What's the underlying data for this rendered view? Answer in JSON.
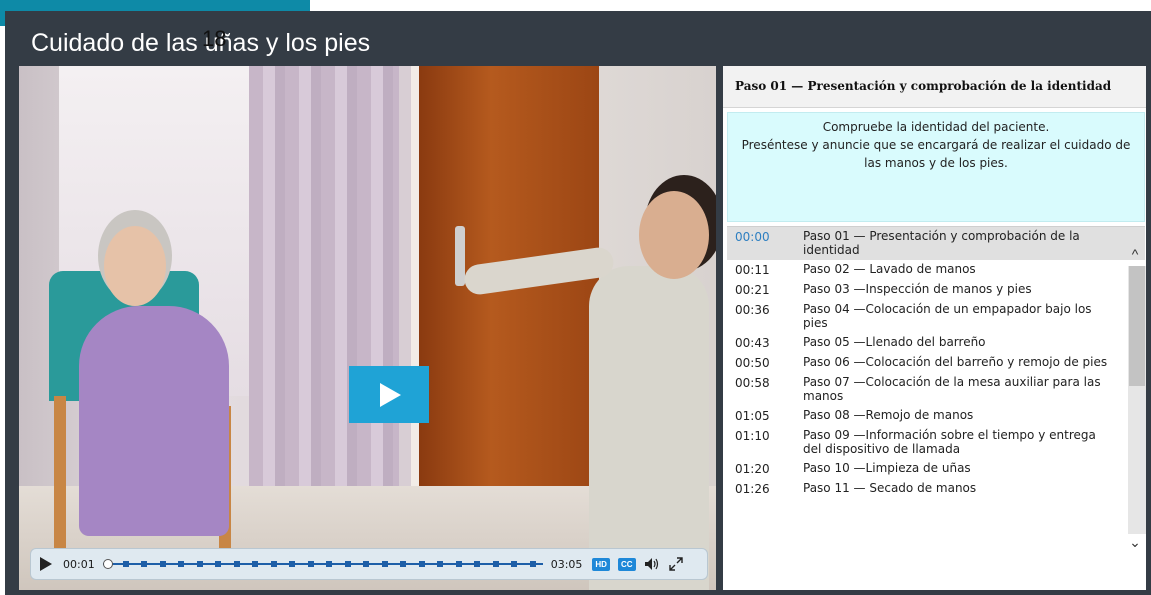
{
  "header": {
    "tab_number": "18",
    "title": "Cuidado de las uñas y los pies"
  },
  "player": {
    "current_time": "00:01",
    "total_time": "03:05",
    "hd_label": "HD",
    "cc_label": "CC",
    "progress_fraction": 0.005
  },
  "panel": {
    "step_title": "Paso 01 — Presentación y comprobación de la identidad",
    "description_lines": [
      "Compruebe la identidad del paciente.",
      "Preséntese y anuncie que se encargará de realizar el cuidado de",
      "las manos y de los pies."
    ],
    "chapters": [
      {
        "time": "00:00",
        "title": "Paso 01 — Presentación y comprobación de la identidad"
      },
      {
        "time": "00:11",
        "title": "Paso 02 — Lavado de manos"
      },
      {
        "time": "00:21",
        "title": "Paso 03 —Inspección de manos y pies"
      },
      {
        "time": "00:36",
        "title": "Paso 04 —Colocación de un empapador bajo los pies"
      },
      {
        "time": "00:43",
        "title": "Paso 05 —Llenado del barreño"
      },
      {
        "time": "00:50",
        "title": "Paso 06 —Colocación del barreño y remojo de pies"
      },
      {
        "time": "00:58",
        "title": "Paso 07 —Colocación de la mesa auxiliar para las manos"
      },
      {
        "time": "01:05",
        "title": "Paso 08 —Remojo de manos"
      },
      {
        "time": "01:10",
        "title": "Paso 09 —Información sobre el tiempo y entrega del dispositivo de llamada"
      },
      {
        "time": "01:20",
        "title": "Paso 10 —Limpieza de uñas"
      },
      {
        "time": "01:26",
        "title": "Paso 11 — Secado de manos"
      }
    ]
  },
  "colors": {
    "accent": "#0e8aa7",
    "play_button": "#1fa3d6",
    "frame": "#343c45",
    "description_bg": "#d9fbfd"
  }
}
